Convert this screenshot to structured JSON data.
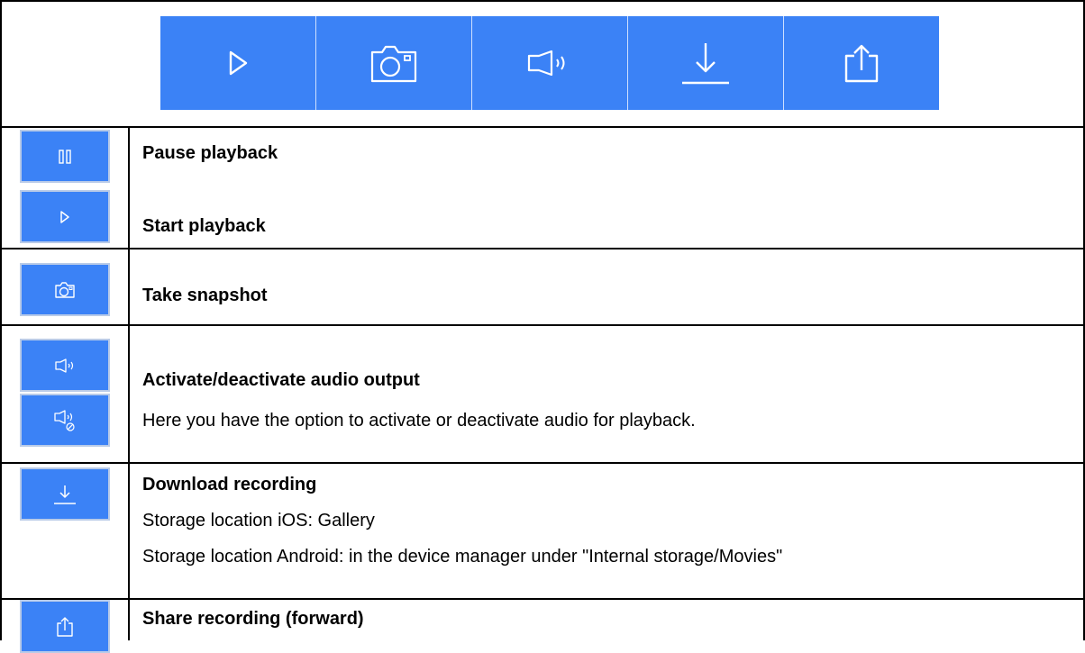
{
  "toolbar": {
    "background": "#3b82f6",
    "buttons": [
      {
        "icon": "play-icon"
      },
      {
        "icon": "camera-icon"
      },
      {
        "icon": "speaker-icon"
      },
      {
        "icon": "download-icon"
      },
      {
        "icon": "share-icon"
      }
    ]
  },
  "rows": {
    "pause": {
      "title": "Pause playback",
      "icon": "pause-icon"
    },
    "start": {
      "title": "Start playback",
      "icon": "play-icon"
    },
    "snapshot": {
      "title": "Take snapshot",
      "icon": "camera-icon"
    },
    "audio": {
      "title": "Activate/deactivate audio output",
      "desc": "Here you have the option to activate or deactivate audio for playback.",
      "icons": [
        "speaker-icon",
        "speaker-muted-icon"
      ]
    },
    "download": {
      "title": "Download recording",
      "line1": "Storage location iOS: Gallery",
      "line2": "Storage location Android: in the device manager under \"Internal storage/Movies\""
    },
    "share": {
      "title": "Share recording (forward)",
      "icon": "share-icon"
    }
  }
}
